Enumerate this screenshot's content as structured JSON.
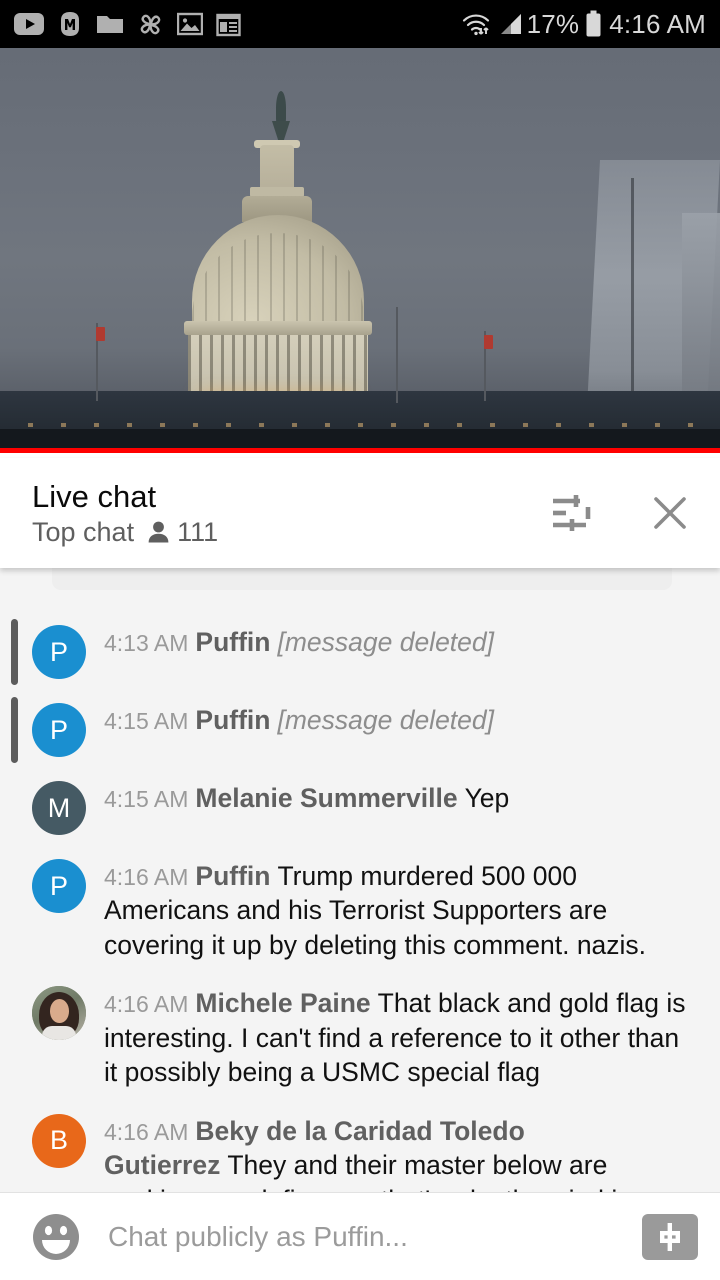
{
  "status_bar": {
    "notification_icons": [
      "youtube-icon",
      "m-badge-icon",
      "folder-icon",
      "pinwheel-icon",
      "photo-icon",
      "calendar-icon"
    ],
    "wifi_icon": "wifi-data-icon",
    "signal_icon": "cellular-signal-icon",
    "battery_percent": "17%",
    "battery_icon": "battery-icon",
    "clock": "4:16 AM"
  },
  "video": {
    "subject": "us-capitol-dome-at-dusk",
    "progress_bar_color": "#ff0000",
    "progress_percent": 100
  },
  "chat_header": {
    "title": "Live chat",
    "mode_label": "Top chat",
    "viewer_icon": "person-icon",
    "viewer_count": "111",
    "settings_icon": "tune-icon",
    "close_icon": "close-icon"
  },
  "messages": [
    {
      "time": "4:13 AM",
      "author": "Puffin",
      "text": "[message deleted]",
      "deleted": true,
      "avatar_type": "initial",
      "avatar_initial": "P",
      "avatar_color": "#1a8fd0"
    },
    {
      "time": "4:15 AM",
      "author": "Puffin",
      "text": "[message deleted]",
      "deleted": true,
      "avatar_type": "initial",
      "avatar_initial": "P",
      "avatar_color": "#1a8fd0"
    },
    {
      "time": "4:15 AM",
      "author": "Melanie Summerville",
      "text": "Yep",
      "deleted": false,
      "avatar_type": "initial",
      "avatar_initial": "M",
      "avatar_color": "#455a64"
    },
    {
      "time": "4:16 AM",
      "author": "Puffin",
      "text": "Trump murdered 500 000 Americans and his Terrorist Supporters are covering it up by deleting this comment. nazis.",
      "deleted": false,
      "avatar_type": "initial",
      "avatar_initial": "P",
      "avatar_color": "#1a8fd0"
    },
    {
      "time": "4:16 AM",
      "author": "Michele Paine",
      "text": "That black and gold flag is interesting. I can't find a reference to it other than it possibly being a USMC special flag",
      "deleted": false,
      "avatar_type": "photo",
      "avatar_initial": "",
      "avatar_color": "#7d8a72"
    },
    {
      "time": "4:16 AM",
      "author": "Beky de la Caridad Toledo Gutierrez",
      "text": "They and their master below are cooking a malefic soup that's why the wind is stirring.",
      "deleted": false,
      "avatar_type": "initial",
      "avatar_initial": "B",
      "avatar_color": "#e8681a"
    }
  ],
  "input_bar": {
    "emoji_icon": "emoji-smiley-icon",
    "placeholder": "Chat publicly as Puffin...",
    "value": "",
    "superchat_icon": "dollar-sign-icon"
  }
}
